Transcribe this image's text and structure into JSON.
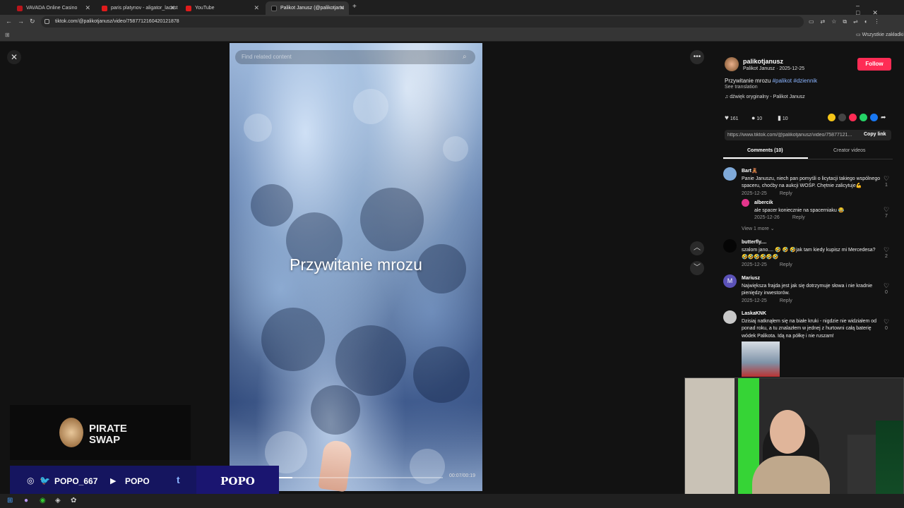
{
  "tabs": [
    {
      "label": "VAVADA Online Casino",
      "color": "#b9151b"
    },
    {
      "label": "paris platynov - aligator_lacost",
      "color": "#e01b1b"
    },
    {
      "label": "YouTube",
      "color": "#e01b1b"
    },
    {
      "label": "Palikot Janusz (@palikotjanu",
      "color": "#111111",
      "active": true
    }
  ],
  "address": {
    "url": "tiktok.com/@palikotjanusz/video/7587712160420121878"
  },
  "bookmarks": {
    "all_label": "Wszystkie zakładki"
  },
  "video": {
    "search_placeholder": "Find related content",
    "title": "Przywitanie mrozu",
    "time": "00:07/00:19",
    "progress": 0.08
  },
  "author": {
    "handle": "palikotjanusz",
    "subline": "Palikot Janusz · 2025-12-25",
    "follow": "Follow"
  },
  "post": {
    "text": "Przywitanie mrozu ",
    "tags": "#palikot #dziennik",
    "see_translation": "See translation",
    "sound": "♫ dźwięk oryginalny - Palikot Janusz"
  },
  "stats": {
    "likes": "161",
    "comments": "10",
    "saves": "10"
  },
  "link": {
    "url": "https://www.tiktok.com/@palikotjanusz/video/75877121...",
    "copy": "Copy link"
  },
  "panel_tabs": {
    "comments": "Comments (10)",
    "creator": "Creator videos"
  },
  "comments": [
    {
      "user": "Bart🧸",
      "text": "Panie Januszu, niech pan pomyśli o licytacji takiego wspólnego spaceru, choćby na aukcji WOŚP. Chętnie zalicytuje💪",
      "date": "2025-12-25",
      "reply": "Reply",
      "likes": "1"
    },
    {
      "user": "albercik",
      "text": "ale spacer koniecznie na spacerniaku 😂",
      "date": "2025-12-26",
      "reply": "Reply",
      "likes": "7"
    },
    {
      "user": "butterfly....",
      "text": "szalom jano.... 🤣 🤣 🤣jak tam kiedy kupisz mi Mercedesa? 🤣🤣🤣🤣🤣🤣",
      "date": "2025-12-25",
      "reply": "Reply",
      "likes": "2"
    },
    {
      "user": "Mariusz",
      "text": "Największa frajda jest jak się dotrzymuje słowa i nie kradnie pieniędzy inwestorów.",
      "date": "2025-12-25",
      "reply": "Reply",
      "likes": "0"
    },
    {
      "user": "LaskaKNK",
      "text": "Dzisiaj natknąłem się na białe kruki - nigdzie nie widziałem od ponad roku, a tu znalazłem w jednej z hurtowni całą baterię wódek Palikota. Idą na półkę i nie ruszam!",
      "likes": "0"
    }
  ],
  "view_more": "View 1 more ⌄",
  "stream": {
    "sponsor": "PIRATE SWAP",
    "twitter": "POPO_667",
    "youtube": "POPO",
    "brand": "POPO"
  },
  "colors": {
    "follow": "#fe2c55",
    "accent": "#8ab4ff"
  }
}
